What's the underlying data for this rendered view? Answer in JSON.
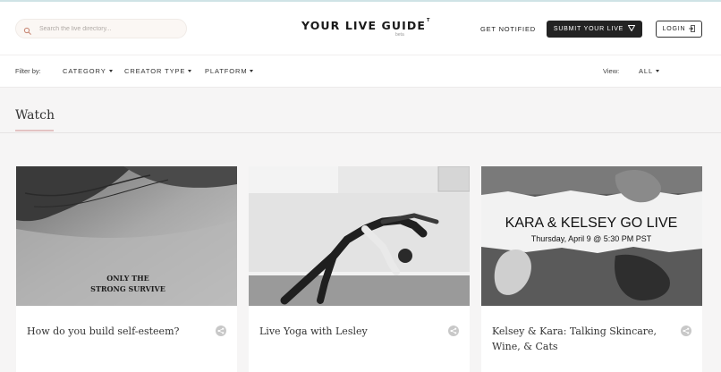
{
  "header": {
    "search_placeholder": "Search the live directory...",
    "logo_text": "YOUR LIVE GUIDE",
    "logo_mark": "T",
    "logo_sub": "beta",
    "get_notified": "GET NOTIFIED",
    "submit_label": "SUBMIT YOUR LIVE",
    "login_label": "LOGIN"
  },
  "filters": {
    "label": "Filter by:",
    "items": [
      "CATEGORY",
      "CREATOR TYPE",
      "PLATFORM"
    ],
    "view_label": "View:",
    "view_value": "ALL"
  },
  "section": {
    "title": "Watch"
  },
  "cards": [
    {
      "title": "How do you build self-esteem?",
      "image_text_1": "ONLY THE",
      "image_text_2": "STRONG SURVIVE"
    },
    {
      "title": "Live Yoga with Lesley"
    },
    {
      "title": "Kelsey & Kara: Talking Skincare, Wine, & Cats",
      "image_heading": "KARA & KELSEY GO LIVE",
      "image_subheading": "Thursday, April 9 @ 5:30 PM PST"
    }
  ],
  "icons": {
    "search": "search-icon",
    "submit": "triangle-down-icon",
    "login": "login-icon",
    "share": "share-icon"
  },
  "colors": {
    "accent_underline": "#e3c3c3",
    "button_dark": "#232323",
    "background": "#f6f5f5"
  }
}
